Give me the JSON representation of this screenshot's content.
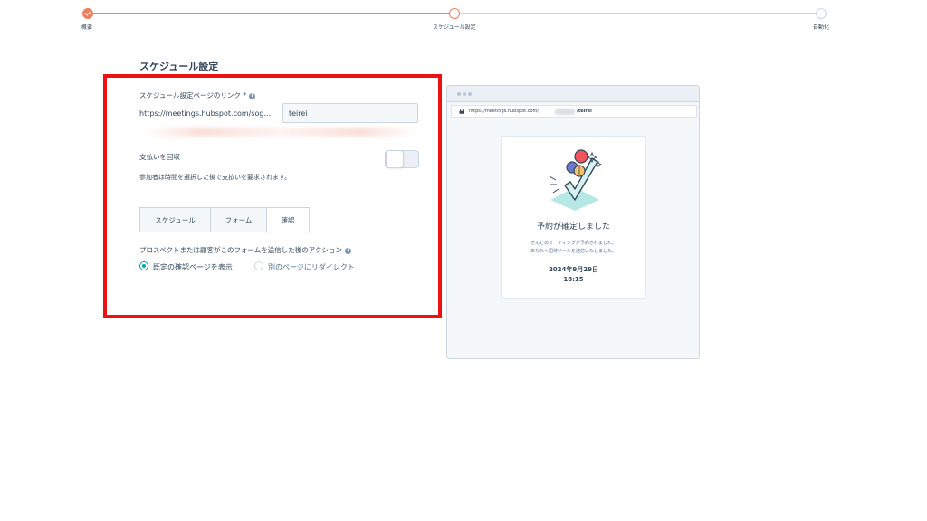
{
  "stepper": {
    "steps": [
      {
        "label": "概要",
        "state": "done"
      },
      {
        "label": "スケジュール設定",
        "state": "current"
      },
      {
        "label": "自動化",
        "state": "todo"
      }
    ],
    "accent_color": "#f07f5e"
  },
  "section": {
    "title": "スケジュール設定"
  },
  "form": {
    "link_label": "スケジュール設定ページのリンク *",
    "url_prefix": "https://meetings.hubspot.com/sog...",
    "slug_value": "teirei",
    "payment_label": "支払いを回収",
    "payment_toggle_on": false,
    "payment_description": "参加者は時間を選択した後で支払いを要求されます。",
    "tabs": [
      {
        "label": "スケジュール",
        "active": false
      },
      {
        "label": "フォーム",
        "active": false
      },
      {
        "label": "確認",
        "active": true
      }
    ],
    "action_label": "プロスペクトまたは顧客がこのフォームを送信した後のアクション",
    "radio_options": [
      {
        "label": "既定の確認ページを表示",
        "selected": true
      },
      {
        "label": "別のページにリダイレクト",
        "selected": false
      }
    ],
    "radio_color": "#00a4bd"
  },
  "highlight_color": "#ee1111",
  "preview": {
    "url": "https://meetings.hubspot.com/",
    "url_slug": "/teirei",
    "heading": "予約が確定しました",
    "message_line1": "さんとのミーティングが予約されました。",
    "message_line2": "あなたへ招待メールを送信いたしました。",
    "date": "2024年9月29日",
    "time": "18:15"
  }
}
